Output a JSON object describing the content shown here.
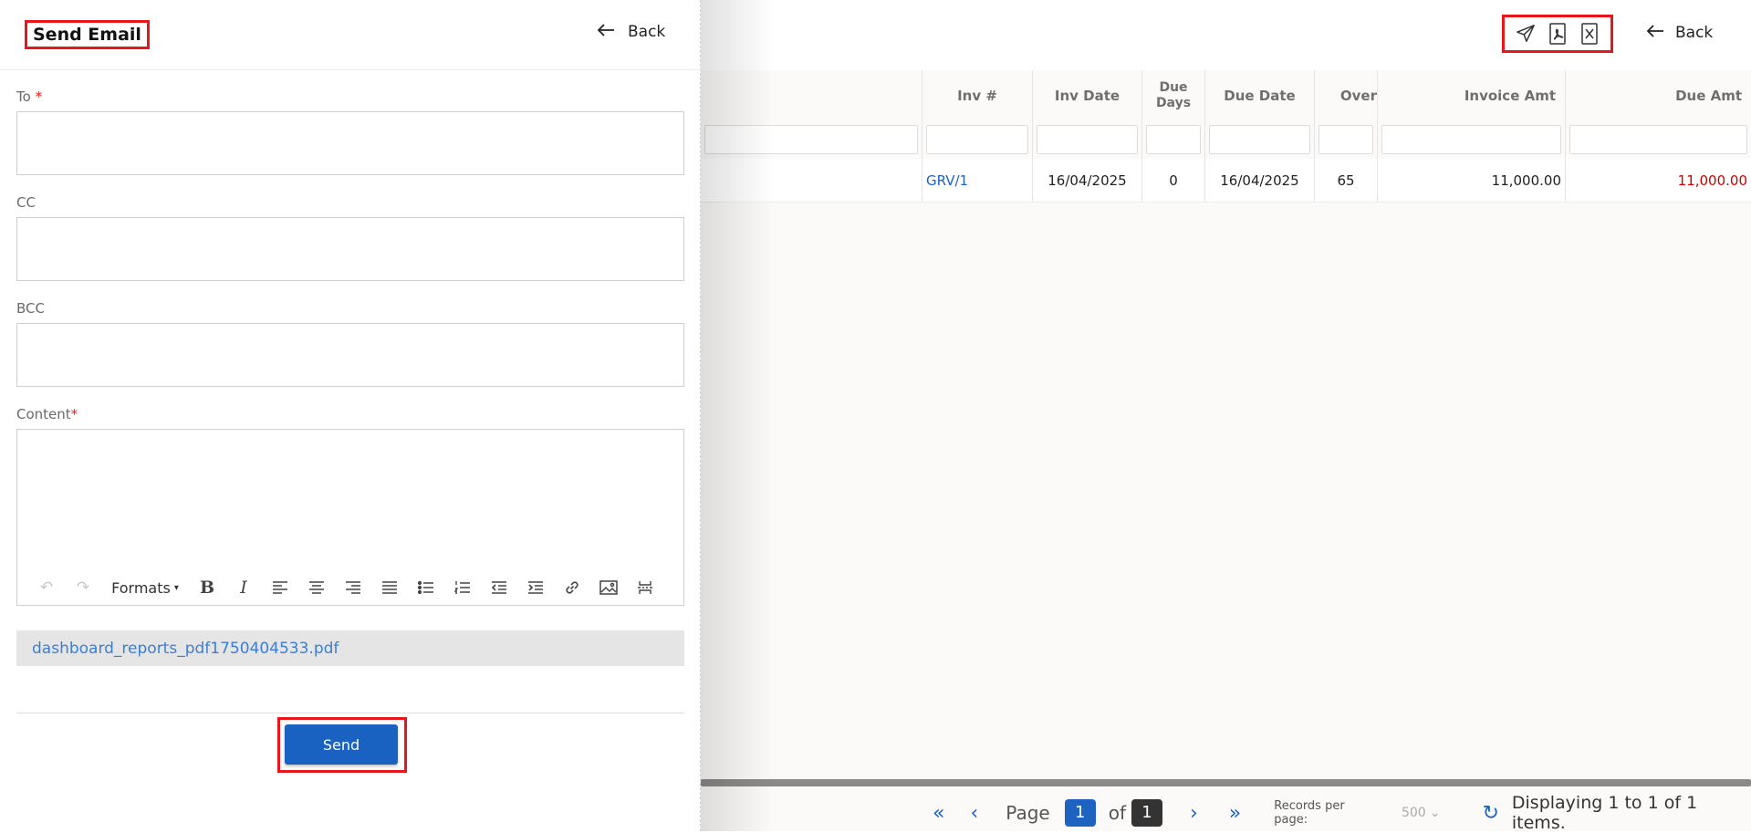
{
  "panel": {
    "title": "Send Email",
    "back_label": "Back",
    "fields": {
      "to_label": "To",
      "to_required": "*",
      "to_value": "",
      "cc_label": "CC",
      "cc_value": "",
      "bcc_label": "BCC",
      "bcc_value": "",
      "content_label": "Content",
      "content_required": "*"
    },
    "editor": {
      "toolbar": [
        {
          "name": "undo-icon",
          "glyph": "↶",
          "disabled": true
        },
        {
          "name": "redo-icon",
          "glyph": "↷",
          "disabled": true
        },
        {
          "name": "formats",
          "label": "Formats"
        },
        {
          "name": "bold-icon",
          "glyph": "B"
        },
        {
          "name": "italic-icon",
          "glyph": "I"
        },
        {
          "name": "align-left-icon"
        },
        {
          "name": "align-center-icon"
        },
        {
          "name": "align-right-icon"
        },
        {
          "name": "align-justify-icon"
        },
        {
          "name": "bullet-list-icon"
        },
        {
          "name": "numbered-list-icon"
        },
        {
          "name": "outdent-icon"
        },
        {
          "name": "indent-icon"
        },
        {
          "name": "link-icon"
        },
        {
          "name": "image-icon"
        },
        {
          "name": "page-break-icon"
        }
      ],
      "formats_label": "Formats"
    },
    "attachment": "dashboard_reports_pdf1750404533.pdf",
    "send_label": "Send"
  },
  "report": {
    "back_label": "Back",
    "action_icons": [
      "send-icon",
      "pdf-export-icon",
      "excel-export-icon"
    ],
    "columns": [
      "Inv #",
      "Inv Date",
      "Due Days",
      "Due Date",
      "Over",
      "Invoice Amt",
      "Due Amt"
    ],
    "rows": [
      {
        "inv": "GRV/1",
        "inv_date": "16/04/2025",
        "due_days": "0",
        "due_date": "16/04/2025",
        "over": "65",
        "invoice_amt": "11,000.00",
        "due_amt": "11,000.00"
      }
    ],
    "pager": {
      "page_label": "Page",
      "current_page": "1",
      "of_label": "of",
      "total_pages": "1",
      "records_per_page_label": "Records per page:",
      "records_per_page": "500",
      "display_text": "Displaying 1 to 1 of 1 items."
    }
  },
  "colors": {
    "accent": "#1a62c2",
    "highlight": "#e8151b",
    "link": "#1e63bf",
    "negative": "#cc0000"
  }
}
